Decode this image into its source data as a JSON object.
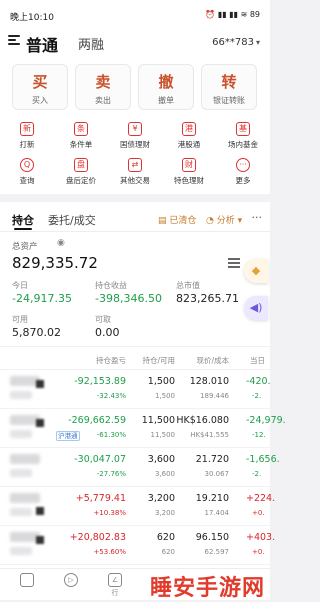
{
  "status_bar": {
    "time": "晚上10:10",
    "icons": "⏰ ▮▮ ▮▮ ≋ 89"
  },
  "header": {
    "tab_active": "普通",
    "tab_other": "两融",
    "account": "66**783"
  },
  "actions": [
    {
      "big": "买",
      "small": "买入"
    },
    {
      "big": "卖",
      "small": "卖出"
    },
    {
      "big": "撤",
      "small": "撤单"
    },
    {
      "big": "转",
      "small": "银证转账"
    }
  ],
  "grid": [
    {
      "label": "打新",
      "icon": "new-stock-icon",
      "glyph": "新"
    },
    {
      "label": "条件单",
      "icon": "condition-order-icon",
      "glyph": "条"
    },
    {
      "label": "国债理财",
      "icon": "bond-icon",
      "glyph": "¥"
    },
    {
      "label": "港股通",
      "icon": "hk-connect-icon",
      "glyph": "港"
    },
    {
      "label": "场内基金",
      "icon": "fund-icon",
      "glyph": "基"
    },
    {
      "label": "查询",
      "icon": "query-icon",
      "glyph": "Q"
    },
    {
      "label": "盘后定价",
      "icon": "after-hours-icon",
      "glyph": "盘"
    },
    {
      "label": "其他交易",
      "icon": "other-trade-icon",
      "glyph": "⇄"
    },
    {
      "label": "特色理财",
      "icon": "wealth-icon",
      "glyph": "财"
    },
    {
      "label": "更多",
      "icon": "more-icon",
      "glyph": "···"
    }
  ],
  "tabs": {
    "holdings": "持仓",
    "orders": "委托/成交",
    "cleared": "已清仓",
    "analysis": "分析",
    "more": "···"
  },
  "summary": {
    "total_label": "总资产",
    "total_value": "829,335.72",
    "today_label": "今日",
    "today_value": "-24,917.35",
    "pnl_label": "持仓收益",
    "pnl_value": "-398,346.50",
    "market_label": "总市值",
    "market_value": "823,265.71",
    "available_label": "可用",
    "available_value": "5,870.02",
    "withdraw_label": "可取",
    "withdraw_value": "0.00"
  },
  "table": {
    "headers": [
      "持仓盈亏",
      "持仓/可用",
      "现价/成本",
      "当日"
    ],
    "rows": [
      {
        "pnl": "-92,153.89",
        "pnl_pct": "-32.43%",
        "qty": "1,500",
        "avail": "1,500",
        "price": "128.010",
        "cost": "189.446",
        "day": "-420.",
        "day_pct": "-2.",
        "tag": "",
        "pnl_color": "green",
        "day_color": "green"
      },
      {
        "pnl": "-269,662.59",
        "pnl_pct": "-61.30%",
        "qty": "11,500",
        "avail": "11,500",
        "price": "HK$16.080",
        "cost": "HK$41.555",
        "day": "-24,979.",
        "day_pct": "-12.",
        "tag": "沪港通",
        "pnl_color": "green",
        "day_color": "green"
      },
      {
        "pnl": "-30,047.07",
        "pnl_pct": "-27.76%",
        "qty": "3,600",
        "avail": "3,600",
        "price": "21.720",
        "cost": "30.067",
        "day": "-1,656.",
        "day_pct": "-2.",
        "tag": "",
        "pnl_color": "green",
        "day_color": "green"
      },
      {
        "pnl": "+5,779.41",
        "pnl_pct": "+10.38%",
        "qty": "3,200",
        "avail": "3,200",
        "price": "19.210",
        "cost": "17.404",
        "day": "+224.",
        "day_pct": "+0.",
        "tag": "",
        "pnl_color": "red",
        "day_color": "red"
      },
      {
        "pnl": "+20,802.83",
        "pnl_pct": "+53.60%",
        "qty": "620",
        "avail": "620",
        "price": "96.150",
        "cost": "62.597",
        "day": "+403.",
        "day_pct": "+0.",
        "tag": "",
        "pnl_color": "red",
        "day_color": "red"
      }
    ]
  },
  "bottom_nav": [
    {
      "label": "",
      "icon": "home-icon"
    },
    {
      "label": "",
      "icon": "market-icon"
    },
    {
      "label": "行",
      "icon": "trade-icon"
    }
  ],
  "watermark": "睡安手游网"
}
